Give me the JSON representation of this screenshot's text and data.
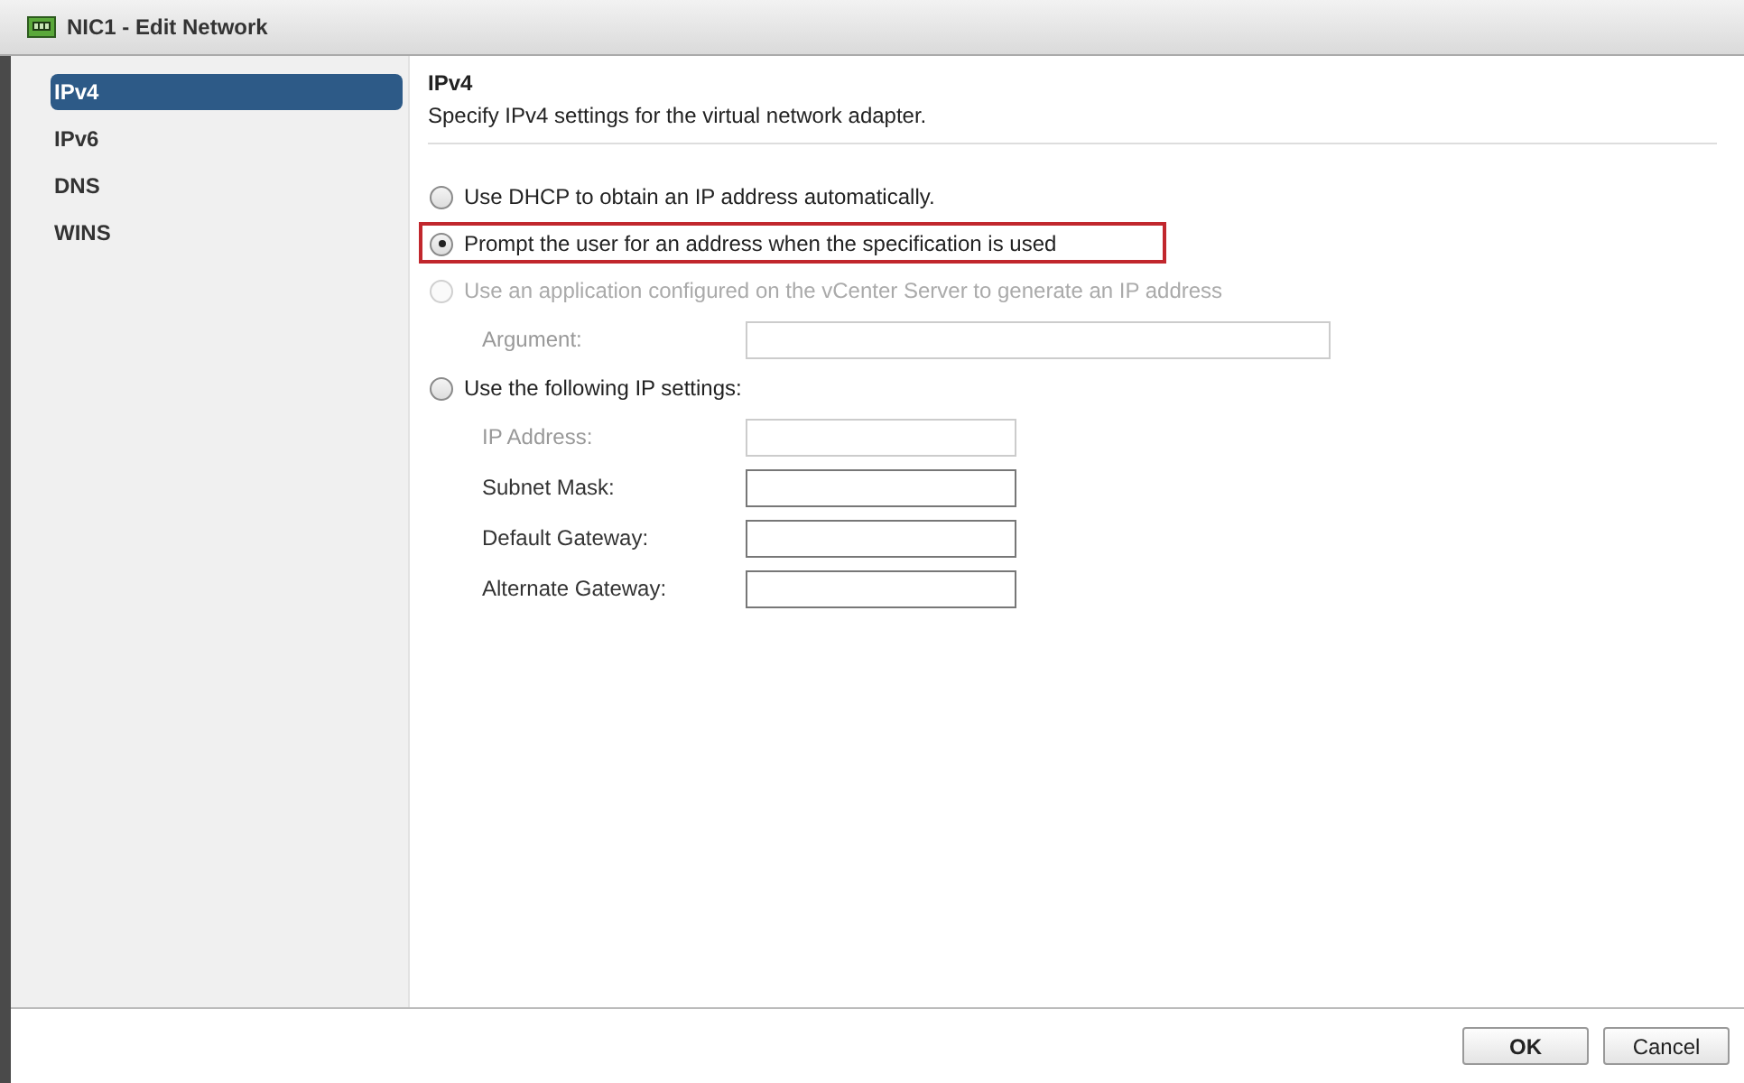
{
  "window": {
    "title": "NIC1 - Edit Network"
  },
  "sidebar": {
    "items": [
      {
        "label": "IPv4",
        "selected": true
      },
      {
        "label": "IPv6",
        "selected": false
      },
      {
        "label": "DNS",
        "selected": false
      },
      {
        "label": "WINS",
        "selected": false
      }
    ]
  },
  "section": {
    "title": "IPv4",
    "description": "Specify IPv4 settings for the virtual network adapter."
  },
  "options": [
    {
      "label": "Use DHCP to obtain an IP address automatically.",
      "selected": false,
      "disabled": false,
      "highlighted": false
    },
    {
      "label": "Prompt the user for an address when the specification is used",
      "selected": true,
      "disabled": false,
      "highlighted": true
    },
    {
      "label": "Use an application configured on the vCenter Server to generate an IP address",
      "selected": false,
      "disabled": true,
      "highlighted": false,
      "fields": [
        {
          "label": "Argument:",
          "disabled": true,
          "kind": "wide"
        }
      ]
    },
    {
      "label": "Use the following IP settings:",
      "selected": false,
      "disabled": false,
      "highlighted": false,
      "fields": [
        {
          "label": "IP Address:",
          "disabled": true,
          "kind": "short"
        },
        {
          "label": "Subnet Mask:",
          "disabled": false,
          "kind": "short"
        },
        {
          "label": "Default Gateway:",
          "disabled": false,
          "kind": "short"
        },
        {
          "label": "Alternate Gateway:",
          "disabled": false,
          "kind": "short"
        }
      ]
    }
  ],
  "buttons": [
    {
      "label": "OK"
    },
    {
      "label": "Cancel"
    }
  ]
}
